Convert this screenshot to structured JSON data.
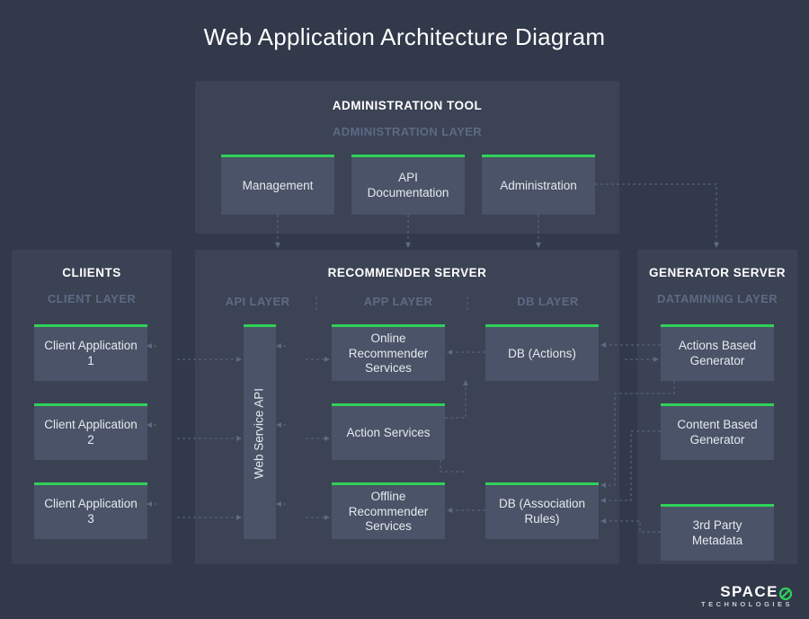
{
  "title": "Web Application Architecture Diagram",
  "admin": {
    "section": "ADMINISTRATION TOOL",
    "layer": "ADMINISTRATION LAYER",
    "nodes": {
      "management": "Management",
      "api_doc": "API Documentation",
      "administration": "Administration"
    }
  },
  "clients": {
    "section": "CLIIENTS",
    "layer": "CLIENT LAYER",
    "nodes": {
      "app1": "Client Application 1",
      "app2": "Client Application 2",
      "app3": "Client Application 3"
    }
  },
  "recommender": {
    "section": "RECOMMENDER SERVER",
    "layers": {
      "api": "API LAYER",
      "app": "APP LAYER",
      "db": "DB LAYER"
    },
    "nodes": {
      "web_service_api": "Web  Service API",
      "online_rec": "Online Recommender Services",
      "action_svc": "Action Services",
      "offline_rec": "Offline Recommender Services",
      "db_actions": "DB (Actions)",
      "db_assoc": "DB (Association Rules)"
    }
  },
  "generator": {
    "section": "GENERATOR SERVER",
    "layer": "DATAMINING LAYER",
    "nodes": {
      "actions_gen": "Actions Based Generator",
      "content_gen": "Content Based Generator",
      "third_party": "3rd Party Metadata"
    }
  },
  "logo": {
    "brand": "SPACE",
    "sub": "TECHNOLOGIES"
  }
}
